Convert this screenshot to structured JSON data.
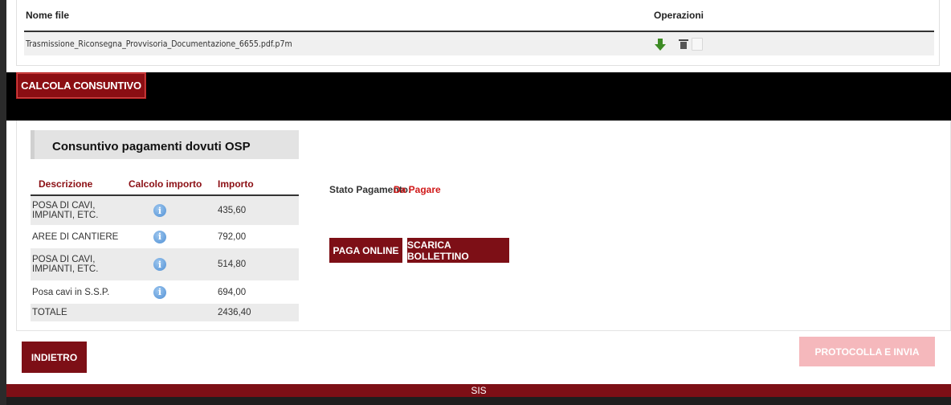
{
  "files": {
    "headers": {
      "name": "Nome file",
      "operations": "Operazioni"
    },
    "rows": [
      {
        "name": "Trasmissione_Riconsegna_Provvisoria_Documentazione_6655.pdf.p7m",
        "icons": [
          "download-icon",
          "trash-icon",
          "document-icon"
        ]
      }
    ]
  },
  "calcola_button": "CALCOLA CONSUNTIVO",
  "summary": {
    "title": "Consuntivo pagamenti dovuti OSP",
    "headers": {
      "description": "Descrizione",
      "calc": "Calcolo importo",
      "amount": "Importo"
    },
    "rows": [
      {
        "description": "POSA DI CAVI, IMPIANTI, ETC.",
        "amount": "435,60",
        "has_info": true
      },
      {
        "description": "AREE DI CANTIERE",
        "amount": "792,00",
        "has_info": true
      },
      {
        "description": "POSA DI CAVI, IMPIANTI, ETC.",
        "amount": "514,80",
        "has_info": true
      },
      {
        "description": "Posa cavi in S.S.P.",
        "amount": "694,00",
        "has_info": true
      }
    ],
    "total": {
      "label": "TOTALE",
      "amount": "2436,40"
    }
  },
  "payment": {
    "status_label": "Stato Pagamento:",
    "status_value": "Da Pagare",
    "status_color": "#d01818",
    "paga_button": "PAGA ONLINE",
    "scarica_button": "SCARICA BOLLETTINO"
  },
  "actions": {
    "back_button": "INDIETRO",
    "protocol_button": "PROTOCOLLA E INVIA"
  },
  "footer": {
    "text": "SIS"
  },
  "colors": {
    "brand": "#7d0f16",
    "disabled_button": "#f5b8bc"
  }
}
